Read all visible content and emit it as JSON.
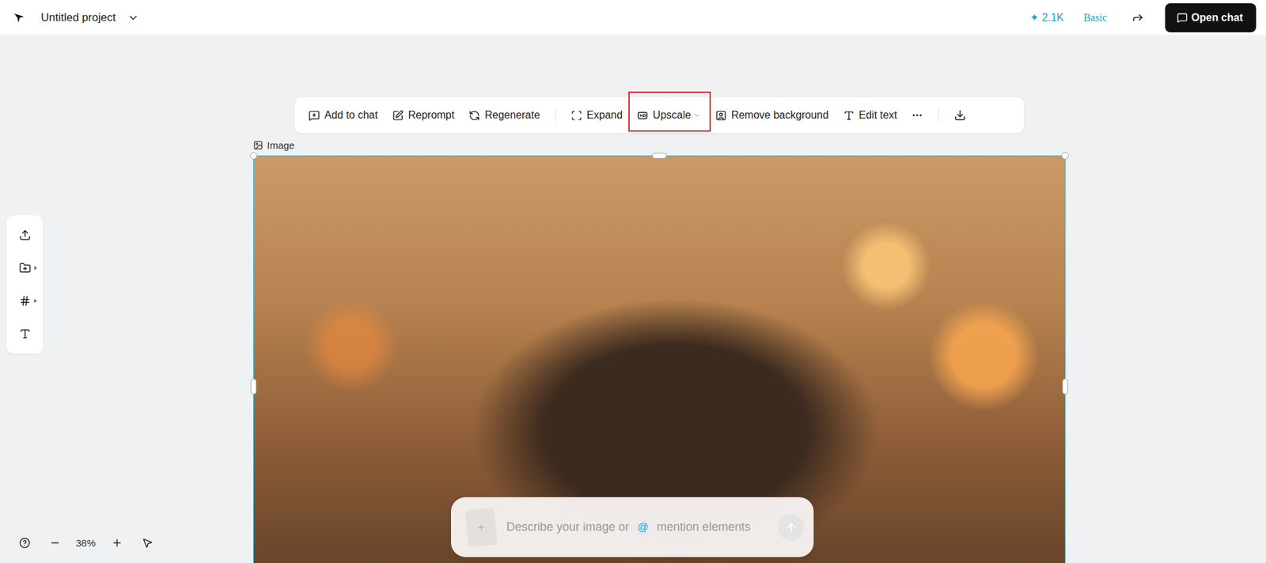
{
  "project": {
    "title": "Untitled project"
  },
  "header": {
    "credit_icon": "✦",
    "credits": "2.1K",
    "plan": "Basic",
    "open_chat": "Open chat"
  },
  "toolbar": {
    "groups": [
      [
        {
          "label": "Add to chat",
          "highlighted": false,
          "has_dropdown": false
        },
        {
          "label": "Reprompt",
          "highlighted": false,
          "has_dropdown": false
        },
        {
          "label": "Regenerate",
          "highlighted": false,
          "has_dropdown": false
        }
      ],
      [
        {
          "label": "Expand",
          "highlighted": false,
          "has_dropdown": false
        },
        {
          "label": "Upscale",
          "highlighted": true,
          "has_dropdown": true
        },
        {
          "label": "Remove background",
          "highlighted": false,
          "has_dropdown": false
        },
        {
          "label": "Edit text",
          "highlighted": false,
          "has_dropdown": false
        }
      ]
    ]
  },
  "element": {
    "label": "Image",
    "selected": true
  },
  "zoom": {
    "level": "38%"
  },
  "prompt": {
    "placeholder_before": "Describe your image or",
    "mention": "@",
    "placeholder_after": "mention elements"
  }
}
